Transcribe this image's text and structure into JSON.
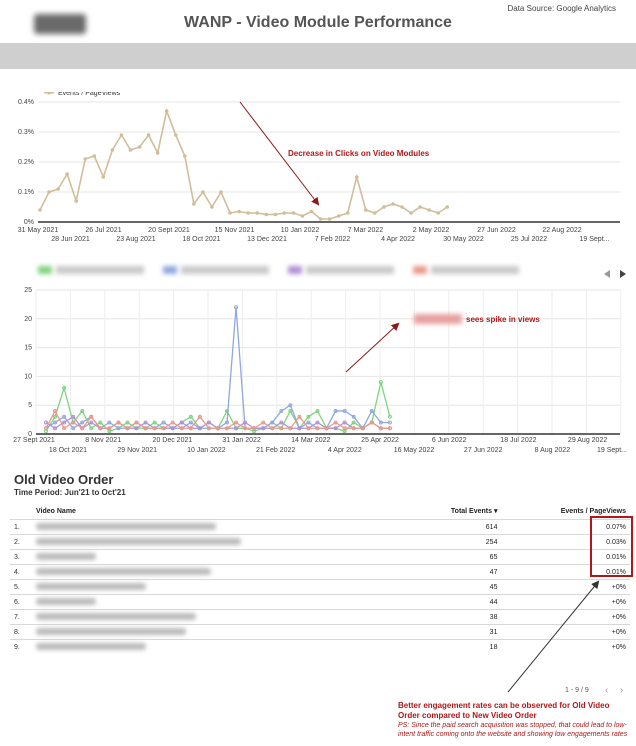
{
  "header": {
    "title": "WANP - Video Module Performance",
    "source": "Data Source: Google Analytics"
  },
  "chart_data": [
    {
      "type": "line",
      "legend": [
        "Events / PageViews"
      ],
      "legend_position": "top-left",
      "grid": true,
      "ylim": [
        0,
        0.4
      ],
      "y_ticks": [
        "0%",
        "0.1%",
        "0.2%",
        "0.3%",
        "0.4%"
      ],
      "x_ticks_top": [
        "31 May 2021",
        "26 Jul 2021",
        "20 Sept 2021",
        "15 Nov 2021",
        "10 Jan 2022",
        "7 Mar 2022",
        "2 May 2022",
        "27 Jun 2022",
        "22 Aug 2022"
      ],
      "x_ticks_bottom": [
        "28 Jun 2021",
        "23 Aug 2021",
        "18 Oct 2021",
        "13 Dec 2021",
        "7 Feb 2022",
        "4 Apr 2022",
        "30 May 2022",
        "25 Jul 2022",
        "19 Sept..."
      ],
      "series": [
        {
          "name": "Events / PageViews",
          "color": "#d2bd9a",
          "values": [
            0.04,
            0.1,
            0.11,
            0.16,
            0.07,
            0.21,
            0.22,
            0.15,
            0.24,
            0.29,
            0.24,
            0.25,
            0.29,
            0.23,
            0.37,
            0.29,
            0.22,
            0.06,
            0.1,
            0.05,
            0.1,
            0.03,
            0.035,
            0.03,
            0.03,
            0.025,
            0.025,
            0.03,
            0.03,
            0.02,
            0.035,
            0.01,
            0.01,
            0.02,
            0.03,
            0.15,
            0.04,
            0.03,
            0.05,
            0.06,
            0.05,
            0.03,
            0.05,
            0.04,
            0.03,
            0.05
          ]
        }
      ],
      "annotation": "Decrease in Clicks on Video Modules"
    },
    {
      "type": "line",
      "grid": true,
      "ylim": [
        0,
        25
      ],
      "y_ticks": [
        "0",
        "5",
        "10",
        "15",
        "20",
        "25"
      ],
      "x_ticks_top": [
        "27 Sept 2021",
        "8 Nov 2021",
        "20 Dec 2021",
        "31 Jan 2022",
        "14 Mar 2022",
        "25 Apr 2022",
        "6 Jun 2022",
        "18 Jul 2022",
        "29 Aug 2022"
      ],
      "x_ticks_bottom": [
        "18 Oct 2021",
        "29 Nov 2021",
        "10 Jan 2022",
        "21 Feb 2022",
        "4 Apr 2022",
        "16 May 2022",
        "27 Jun 2022",
        "8 Aug 2022",
        "19 Sept..."
      ],
      "series": [
        {
          "color": "#7fd37f",
          "values": [
            0.5,
            3,
            8,
            2,
            4,
            1,
            2,
            0.5,
            1,
            2,
            1,
            1,
            2,
            1,
            1,
            2,
            3,
            1,
            2,
            1,
            4,
            1,
            1,
            0.5,
            1,
            2,
            1,
            4,
            1,
            3,
            4,
            1,
            1,
            0.5,
            2,
            1,
            2,
            9,
            3
          ]
        },
        {
          "color": "#8fa8e0",
          "values": [
            1,
            2,
            3,
            1,
            2,
            3,
            1,
            2,
            1,
            1,
            2,
            1,
            1,
            2,
            1,
            1,
            2,
            1,
            1,
            1,
            2,
            22,
            1,
            1,
            1,
            2,
            4,
            5,
            1,
            2,
            1,
            1,
            4,
            4,
            3,
            1,
            4,
            2,
            2
          ]
        },
        {
          "color": "#b28fd6",
          "values": [
            2,
            1,
            2,
            3,
            1,
            2,
            1,
            1,
            2,
            1,
            1,
            2,
            1,
            1,
            1,
            2,
            1,
            1,
            2,
            1,
            1,
            1,
            2,
            1,
            1,
            1,
            2,
            1,
            1,
            1,
            2,
            1,
            1,
            2,
            1,
            1,
            2,
            1,
            1
          ]
        },
        {
          "color": "#e89a8a",
          "values": [
            1,
            4,
            1,
            2,
            1,
            3,
            1,
            1,
            2,
            1,
            2,
            1,
            1,
            1,
            2,
            1,
            1,
            3,
            1,
            1,
            1,
            2,
            1,
            1,
            2,
            1,
            1,
            1,
            3,
            1,
            1,
            1,
            2,
            1,
            1,
            1,
            2,
            1,
            1
          ]
        }
      ],
      "annotation": "sees spike in views"
    },
    {
      "type": "table",
      "title": "Old Video Order",
      "period": "Time Period: Jun'21 to Oct'21",
      "columns": [
        "Video Name",
        "Total Events ▾",
        "Events / PageViews"
      ],
      "rows": [
        {
          "idx": "1.",
          "events": "614",
          "ratio": "0.07%"
        },
        {
          "idx": "2.",
          "events": "254",
          "ratio": "0.03%"
        },
        {
          "idx": "3.",
          "events": "65",
          "ratio": "0.01%"
        },
        {
          "idx": "4.",
          "events": "47",
          "ratio": "0.01%"
        },
        {
          "idx": "5.",
          "events": "45",
          "ratio": "+0%"
        },
        {
          "idx": "6.",
          "events": "44",
          "ratio": "+0%"
        },
        {
          "idx": "7.",
          "events": "38",
          "ratio": "+0%"
        },
        {
          "idx": "8.",
          "events": "31",
          "ratio": "+0%"
        },
        {
          "idx": "9.",
          "events": "18",
          "ratio": "+0%"
        }
      ],
      "pagination": "1 - 9 / 9"
    }
  ],
  "note": {
    "main": "Better engagement rates can be observed for Old Video Order compared to New Video Order",
    "ps": "PS: Since the paid search acquisition was stopped, that could lead to low-intent traffic coming onto the website and showing low engagements rates"
  }
}
